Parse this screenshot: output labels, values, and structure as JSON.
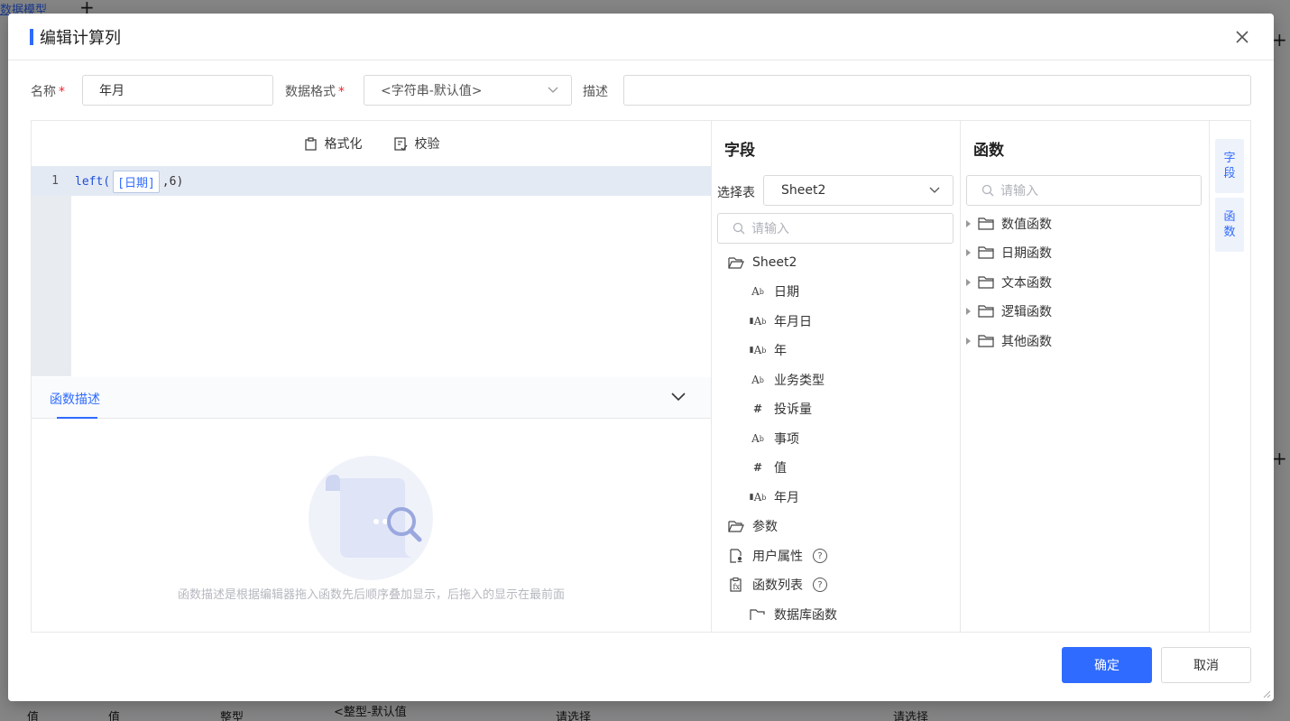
{
  "background": {
    "tab_label": "数据模型",
    "bottom_cells": [
      "值",
      "值",
      "整型",
      "<整型-默认值",
      "请选择",
      "请选择"
    ]
  },
  "modal": {
    "title": "编辑计算列",
    "form": {
      "name_label": "名称",
      "required_mark": "*",
      "name_value": "年月",
      "format_label": "数据格式",
      "format_value": "<字符串-默认值>",
      "desc_label": "描述",
      "desc_value": ""
    },
    "editor": {
      "format_button": "格式化",
      "validate_button": "校验",
      "line_number": "1",
      "code": {
        "func": "left(",
        "field": "[日期]",
        "rest": ",6)"
      }
    },
    "description": {
      "tab_label": "函数描述",
      "empty_text": "函数描述是根据编辑器拖入函数先后顺序叠加显示，后拖入的显示在最前面"
    },
    "fields_panel": {
      "title": "字段",
      "select_table_label": "选择表",
      "select_table_value": "Sheet2",
      "search_placeholder": "请输入",
      "tree": [
        {
          "label": "Sheet2",
          "icon": "folder-open-icon",
          "level": 0
        },
        {
          "label": "日期",
          "icon": "Ab",
          "level": 1
        },
        {
          "label": "年月日",
          "icon": "calc-Ab",
          "level": 1
        },
        {
          "label": "年",
          "icon": "calc-Ab",
          "level": 1
        },
        {
          "label": "业务类型",
          "icon": "Ab",
          "level": 1
        },
        {
          "label": "投诉量",
          "icon": "#",
          "level": 1
        },
        {
          "label": "事项",
          "icon": "Ab",
          "level": 1
        },
        {
          "label": "值",
          "icon": "#",
          "level": 1
        },
        {
          "label": "年月",
          "icon": "calc-Ab",
          "level": 1
        },
        {
          "label": "参数",
          "icon": "folder-open-icon",
          "level": 0
        },
        {
          "label": "用户属性",
          "icon": "user-attr-icon",
          "level": 0
        },
        {
          "label": "函数列表",
          "icon": "function-list-icon",
          "level": 0
        },
        {
          "label": "数据库函数",
          "icon": "folder-flag-icon",
          "level": 1
        }
      ],
      "help_glyph": "?"
    },
    "functions_panel": {
      "title": "函数",
      "search_placeholder": "请输入",
      "items": [
        "数值函数",
        "日期函数",
        "文本函数",
        "逻辑函数",
        "其他函数"
      ]
    },
    "side_tabs": [
      {
        "line1": "字",
        "line2": "段"
      },
      {
        "line1": "函",
        "line2": "数"
      }
    ],
    "confirm_button": "确定",
    "cancel_button": "取消"
  },
  "colors": {
    "accent": "#2f6bff",
    "required": "#f5222d",
    "active_line": "#e4eaf4"
  }
}
